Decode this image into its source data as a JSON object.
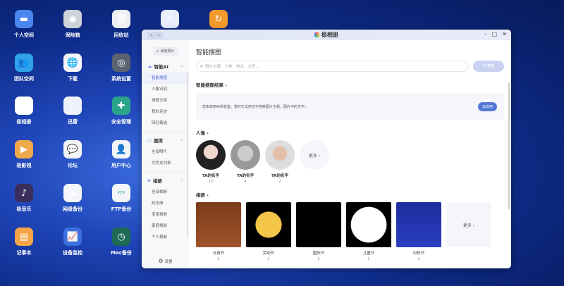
{
  "desktop": [
    {
      "label": "个人空间",
      "icon": "folder-icon",
      "color": "#4a86f0"
    },
    {
      "label": "保险箱",
      "icon": "safe-icon",
      "color": "#cfd2d8"
    },
    {
      "label": "回收站",
      "icon": "trash-icon",
      "color": "#eef0f3"
    },
    {
      "label": "",
      "icon": "lightning-icon",
      "color": "#e8eefc"
    },
    {
      "label": "",
      "icon": "sync-icon",
      "color": "#f39a2c"
    },
    {
      "label": "团队空间",
      "icon": "team-folder-icon",
      "color": "#2fa3ea"
    },
    {
      "label": "下载",
      "icon": "globe-download-icon",
      "color": "#f3f5f8"
    },
    {
      "label": "系统设置",
      "icon": "settings-icon",
      "color": "#5b6270"
    },
    {
      "label": "极相册",
      "icon": "photos-icon",
      "color": "#ffffff"
    },
    {
      "label": "迅雷",
      "icon": "thunder-bird-icon",
      "color": "#eef2fb"
    },
    {
      "label": "安全管理",
      "icon": "shield-icon",
      "color": "#2aa58a"
    },
    {
      "label": "极影视",
      "icon": "video-icon",
      "color": "#f0a94a"
    },
    {
      "label": "论坛",
      "icon": "chat-icon",
      "color": "#f3f5f8"
    },
    {
      "label": "用户中心",
      "icon": "user-icon",
      "color": "#f3f5f8"
    },
    {
      "label": "极音乐",
      "icon": "music-icon",
      "color": "#3a2f5c"
    },
    {
      "label": "网盘备份",
      "icon": "cloud-backup-icon",
      "color": "#f3f5f8"
    },
    {
      "label": "FTP备份",
      "icon": "ftp-icon",
      "color": "#f3f5f8"
    },
    {
      "label": "记事本",
      "icon": "notepad-icon",
      "color": "#f5a547"
    },
    {
      "label": "设备监控",
      "icon": "chart-icon",
      "color": "#3c6fe0"
    },
    {
      "label": "Mac备份",
      "icon": "time-machine-icon",
      "color": "#1f6a55"
    }
  ],
  "window": {
    "title": "极相册",
    "back": "‹",
    "forward": "›"
  },
  "sidebar": {
    "add_label": "+ 添加照片",
    "groups": [
      {
        "label": "智能AI",
        "items": [
          "智能搜图",
          "人像识别",
          "场景分类",
          "我的足迹",
          "回忆精选"
        ]
      },
      {
        "label": "图库",
        "items": [
          "全部照片",
          "文件夹列表"
        ]
      },
      {
        "label": "相册",
        "items": [
          "全部相册",
          "纪念册",
          "宝宝相册",
          "家庭相册",
          "个人相册"
        ]
      }
    ],
    "settings": "设置"
  },
  "main": {
    "title": "智能搜图",
    "search_placeholder": "图片主题、人物、地点、文字...",
    "ai_search": "AI 搜索",
    "results_title": "智能搜图结果 ›",
    "notice": "您未启用AI实验室，暂时无法用文字搜索图片主题、图片中的文字。",
    "enable_btn": "去启用",
    "people_title": "人像 ›",
    "people": [
      {
        "name": "TA的名字",
        "count": "15"
      },
      {
        "name": "TA的名字",
        "count": "4"
      },
      {
        "name": "TA的名字",
        "count": "2"
      }
    ],
    "more": "更多 ›",
    "albums_title": "相册 ›",
    "albums": [
      {
        "name": "元宵节",
        "count": "3"
      },
      {
        "name": "劳动节",
        "count": "2"
      },
      {
        "name": "国庆节",
        "count": "1"
      },
      {
        "name": "儿童节",
        "count": "1"
      },
      {
        "name": "中秋节",
        "count": "1"
      }
    ]
  }
}
